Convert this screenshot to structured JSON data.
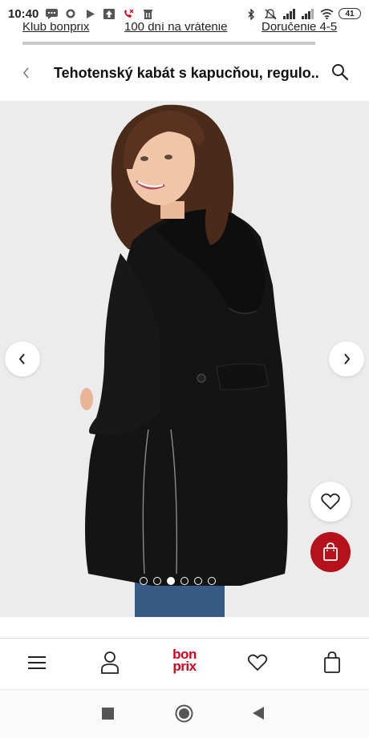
{
  "status_bar": {
    "time": "10:40",
    "battery": "41",
    "icons_left": [
      "chat-icon",
      "whatsapp-icon",
      "play-icon",
      "upload-icon",
      "missed-call-icon",
      "trash-icon"
    ],
    "icons_right": [
      "bluetooth-icon",
      "mute-icon",
      "signal-icon",
      "signal-icon",
      "wifi-icon"
    ]
  },
  "promo": {
    "links": [
      "Klub bonprix",
      "100 dní na vrátenie",
      "Doručenie 4-5"
    ]
  },
  "header": {
    "title": "Tehotenský kabát s kapucňou, regulo..."
  },
  "gallery": {
    "image_count": 6,
    "active_index": 2
  },
  "colors": {
    "brand_red": "#d0021b",
    "cart_button": "#b5121b",
    "coat": "#141414",
    "background": "#ececec"
  },
  "bottom_nav": {
    "logo_top": "bon",
    "logo_bottom": "prix",
    "items": [
      "menu-icon",
      "account-icon",
      "logo",
      "wishlist-icon",
      "cart-icon"
    ]
  },
  "system_nav": [
    "recents-icon",
    "home-icon",
    "back-icon"
  ]
}
